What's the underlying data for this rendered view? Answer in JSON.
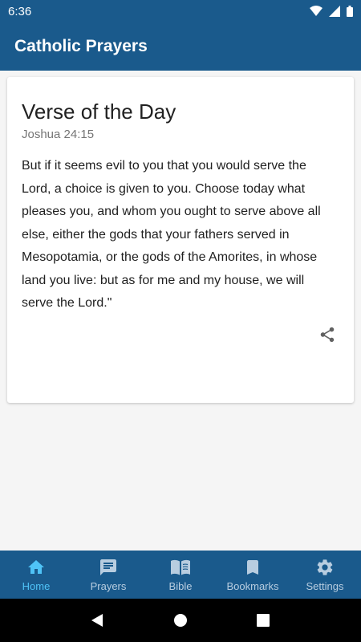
{
  "status_bar": {
    "time": "6:36"
  },
  "app_bar": {
    "title": "Catholic Prayers"
  },
  "verse_card": {
    "title": "Verse of the Day",
    "reference": "Joshua 24:15",
    "text": "But if it seems evil to you that you would serve the Lord, a choice is given to you. Choose today what pleases you, and whom you ought to serve above all else, either the gods that your fathers served in Mesopotamia, or the gods of the Amorites, in whose land you live: but as for me and my house, we will serve the Lord.\"",
    "share_icon": "share-icon"
  },
  "bottom_nav": {
    "items": [
      {
        "label": "Home",
        "icon": "home-icon",
        "active": true
      },
      {
        "label": "Prayers",
        "icon": "chat-icon",
        "active": false
      },
      {
        "label": "Bible",
        "icon": "book-icon",
        "active": false
      },
      {
        "label": "Bookmarks",
        "icon": "bookmark-icon",
        "active": false
      },
      {
        "label": "Settings",
        "icon": "gear-icon",
        "active": false
      }
    ]
  },
  "colors": {
    "primary": "#1a5a8c",
    "active": "#4fc3f7",
    "inactive": "#b8cde0"
  }
}
